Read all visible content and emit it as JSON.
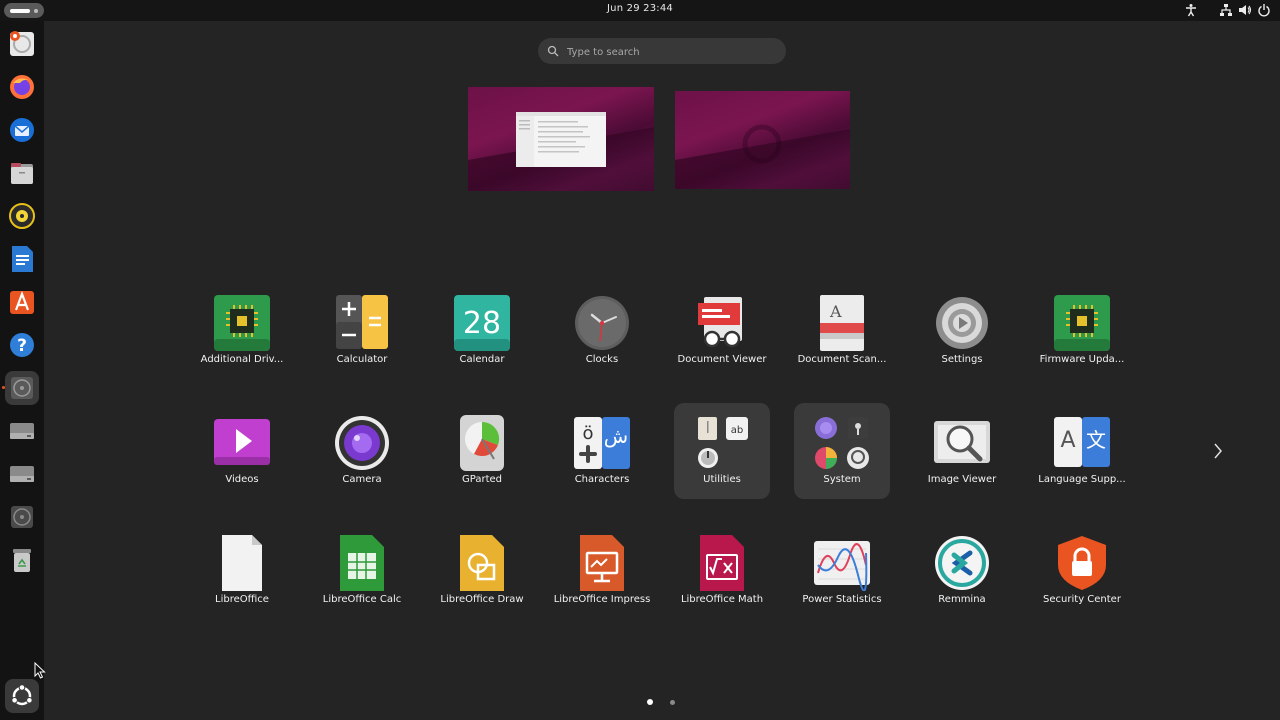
{
  "topbar": {
    "datetime": "Jun 29  23:44",
    "tray_icons": [
      "accessibility-icon",
      "network-icon",
      "volume-icon",
      "power-icon"
    ]
  },
  "search": {
    "placeholder": "Type to search",
    "value": ""
  },
  "dock": {
    "items": [
      {
        "name": "ubuntu-installer-icon"
      },
      {
        "name": "firefox-icon"
      },
      {
        "name": "thunderbird-icon"
      },
      {
        "name": "files-icon"
      },
      {
        "name": "rhythmbox-icon"
      },
      {
        "name": "libreoffice-writer-icon"
      },
      {
        "name": "app-center-icon"
      },
      {
        "name": "help-icon"
      },
      {
        "name": "optical-drive-icon"
      },
      {
        "name": "drive-icon"
      },
      {
        "name": "drive-icon"
      },
      {
        "name": "optical-drive-icon"
      },
      {
        "name": "trash-icon"
      }
    ],
    "show_apps": "show-apps-icon"
  },
  "apps": {
    "row1": [
      {
        "label": "Additional Driv..."
      },
      {
        "label": "Calculator"
      },
      {
        "label": "Calendar",
        "icon_text": "28"
      },
      {
        "label": "Clocks"
      },
      {
        "label": "Document Viewer"
      },
      {
        "label": "Document Scan..."
      },
      {
        "label": "Settings"
      },
      {
        "label": "Firmware Upda..."
      }
    ],
    "row2": [
      {
        "label": "Videos"
      },
      {
        "label": "Camera"
      },
      {
        "label": "GParted"
      },
      {
        "label": "Characters",
        "icon_text_a": "ö",
        "icon_text_b": "ش"
      },
      {
        "label": "Utilities"
      },
      {
        "label": "System"
      },
      {
        "label": "Image Viewer"
      },
      {
        "label": "Language Supp...",
        "icon_text_a": "A",
        "icon_text_b": "文"
      }
    ],
    "row3": [
      {
        "label": "LibreOffice"
      },
      {
        "label": "LibreOffice Calc"
      },
      {
        "label": "LibreOffice Draw"
      },
      {
        "label": "LibreOffice Impress"
      },
      {
        "label": "LibreOffice Math"
      },
      {
        "label": "Power Statistics"
      },
      {
        "label": "Remmina"
      },
      {
        "label": "Security Center"
      }
    ]
  },
  "pagination": {
    "current": 1,
    "total": 2
  },
  "colors": {
    "accent": "#e95420",
    "background": "#242424",
    "topbar": "#151515",
    "dock": "#131313"
  }
}
